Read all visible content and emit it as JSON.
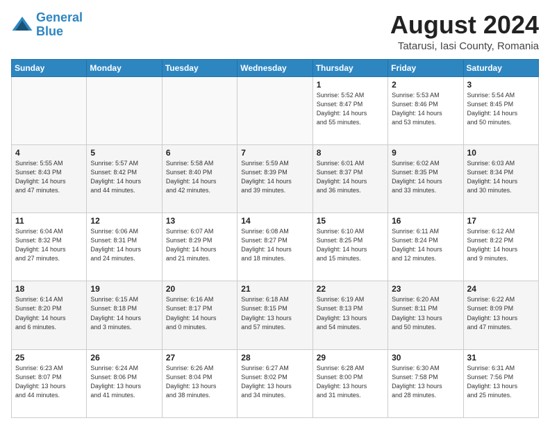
{
  "logo": {
    "line1": "General",
    "line2": "Blue"
  },
  "title": "August 2024",
  "location": "Tatarusi, Iasi County, Romania",
  "weekdays": [
    "Sunday",
    "Monday",
    "Tuesday",
    "Wednesday",
    "Thursday",
    "Friday",
    "Saturday"
  ],
  "weeks": [
    [
      {
        "day": "",
        "info": ""
      },
      {
        "day": "",
        "info": ""
      },
      {
        "day": "",
        "info": ""
      },
      {
        "day": "",
        "info": ""
      },
      {
        "day": "1",
        "info": "Sunrise: 5:52 AM\nSunset: 8:47 PM\nDaylight: 14 hours\nand 55 minutes."
      },
      {
        "day": "2",
        "info": "Sunrise: 5:53 AM\nSunset: 8:46 PM\nDaylight: 14 hours\nand 53 minutes."
      },
      {
        "day": "3",
        "info": "Sunrise: 5:54 AM\nSunset: 8:45 PM\nDaylight: 14 hours\nand 50 minutes."
      }
    ],
    [
      {
        "day": "4",
        "info": "Sunrise: 5:55 AM\nSunset: 8:43 PM\nDaylight: 14 hours\nand 47 minutes."
      },
      {
        "day": "5",
        "info": "Sunrise: 5:57 AM\nSunset: 8:42 PM\nDaylight: 14 hours\nand 44 minutes."
      },
      {
        "day": "6",
        "info": "Sunrise: 5:58 AM\nSunset: 8:40 PM\nDaylight: 14 hours\nand 42 minutes."
      },
      {
        "day": "7",
        "info": "Sunrise: 5:59 AM\nSunset: 8:39 PM\nDaylight: 14 hours\nand 39 minutes."
      },
      {
        "day": "8",
        "info": "Sunrise: 6:01 AM\nSunset: 8:37 PM\nDaylight: 14 hours\nand 36 minutes."
      },
      {
        "day": "9",
        "info": "Sunrise: 6:02 AM\nSunset: 8:35 PM\nDaylight: 14 hours\nand 33 minutes."
      },
      {
        "day": "10",
        "info": "Sunrise: 6:03 AM\nSunset: 8:34 PM\nDaylight: 14 hours\nand 30 minutes."
      }
    ],
    [
      {
        "day": "11",
        "info": "Sunrise: 6:04 AM\nSunset: 8:32 PM\nDaylight: 14 hours\nand 27 minutes."
      },
      {
        "day": "12",
        "info": "Sunrise: 6:06 AM\nSunset: 8:31 PM\nDaylight: 14 hours\nand 24 minutes."
      },
      {
        "day": "13",
        "info": "Sunrise: 6:07 AM\nSunset: 8:29 PM\nDaylight: 14 hours\nand 21 minutes."
      },
      {
        "day": "14",
        "info": "Sunrise: 6:08 AM\nSunset: 8:27 PM\nDaylight: 14 hours\nand 18 minutes."
      },
      {
        "day": "15",
        "info": "Sunrise: 6:10 AM\nSunset: 8:25 PM\nDaylight: 14 hours\nand 15 minutes."
      },
      {
        "day": "16",
        "info": "Sunrise: 6:11 AM\nSunset: 8:24 PM\nDaylight: 14 hours\nand 12 minutes."
      },
      {
        "day": "17",
        "info": "Sunrise: 6:12 AM\nSunset: 8:22 PM\nDaylight: 14 hours\nand 9 minutes."
      }
    ],
    [
      {
        "day": "18",
        "info": "Sunrise: 6:14 AM\nSunset: 8:20 PM\nDaylight: 14 hours\nand 6 minutes."
      },
      {
        "day": "19",
        "info": "Sunrise: 6:15 AM\nSunset: 8:18 PM\nDaylight: 14 hours\nand 3 minutes."
      },
      {
        "day": "20",
        "info": "Sunrise: 6:16 AM\nSunset: 8:17 PM\nDaylight: 14 hours\nand 0 minutes."
      },
      {
        "day": "21",
        "info": "Sunrise: 6:18 AM\nSunset: 8:15 PM\nDaylight: 13 hours\nand 57 minutes."
      },
      {
        "day": "22",
        "info": "Sunrise: 6:19 AM\nSunset: 8:13 PM\nDaylight: 13 hours\nand 54 minutes."
      },
      {
        "day": "23",
        "info": "Sunrise: 6:20 AM\nSunset: 8:11 PM\nDaylight: 13 hours\nand 50 minutes."
      },
      {
        "day": "24",
        "info": "Sunrise: 6:22 AM\nSunset: 8:09 PM\nDaylight: 13 hours\nand 47 minutes."
      }
    ],
    [
      {
        "day": "25",
        "info": "Sunrise: 6:23 AM\nSunset: 8:07 PM\nDaylight: 13 hours\nand 44 minutes."
      },
      {
        "day": "26",
        "info": "Sunrise: 6:24 AM\nSunset: 8:06 PM\nDaylight: 13 hours\nand 41 minutes."
      },
      {
        "day": "27",
        "info": "Sunrise: 6:26 AM\nSunset: 8:04 PM\nDaylight: 13 hours\nand 38 minutes."
      },
      {
        "day": "28",
        "info": "Sunrise: 6:27 AM\nSunset: 8:02 PM\nDaylight: 13 hours\nand 34 minutes."
      },
      {
        "day": "29",
        "info": "Sunrise: 6:28 AM\nSunset: 8:00 PM\nDaylight: 13 hours\nand 31 minutes."
      },
      {
        "day": "30",
        "info": "Sunrise: 6:30 AM\nSunset: 7:58 PM\nDaylight: 13 hours\nand 28 minutes."
      },
      {
        "day": "31",
        "info": "Sunrise: 6:31 AM\nSunset: 7:56 PM\nDaylight: 13 hours\nand 25 minutes."
      }
    ]
  ]
}
